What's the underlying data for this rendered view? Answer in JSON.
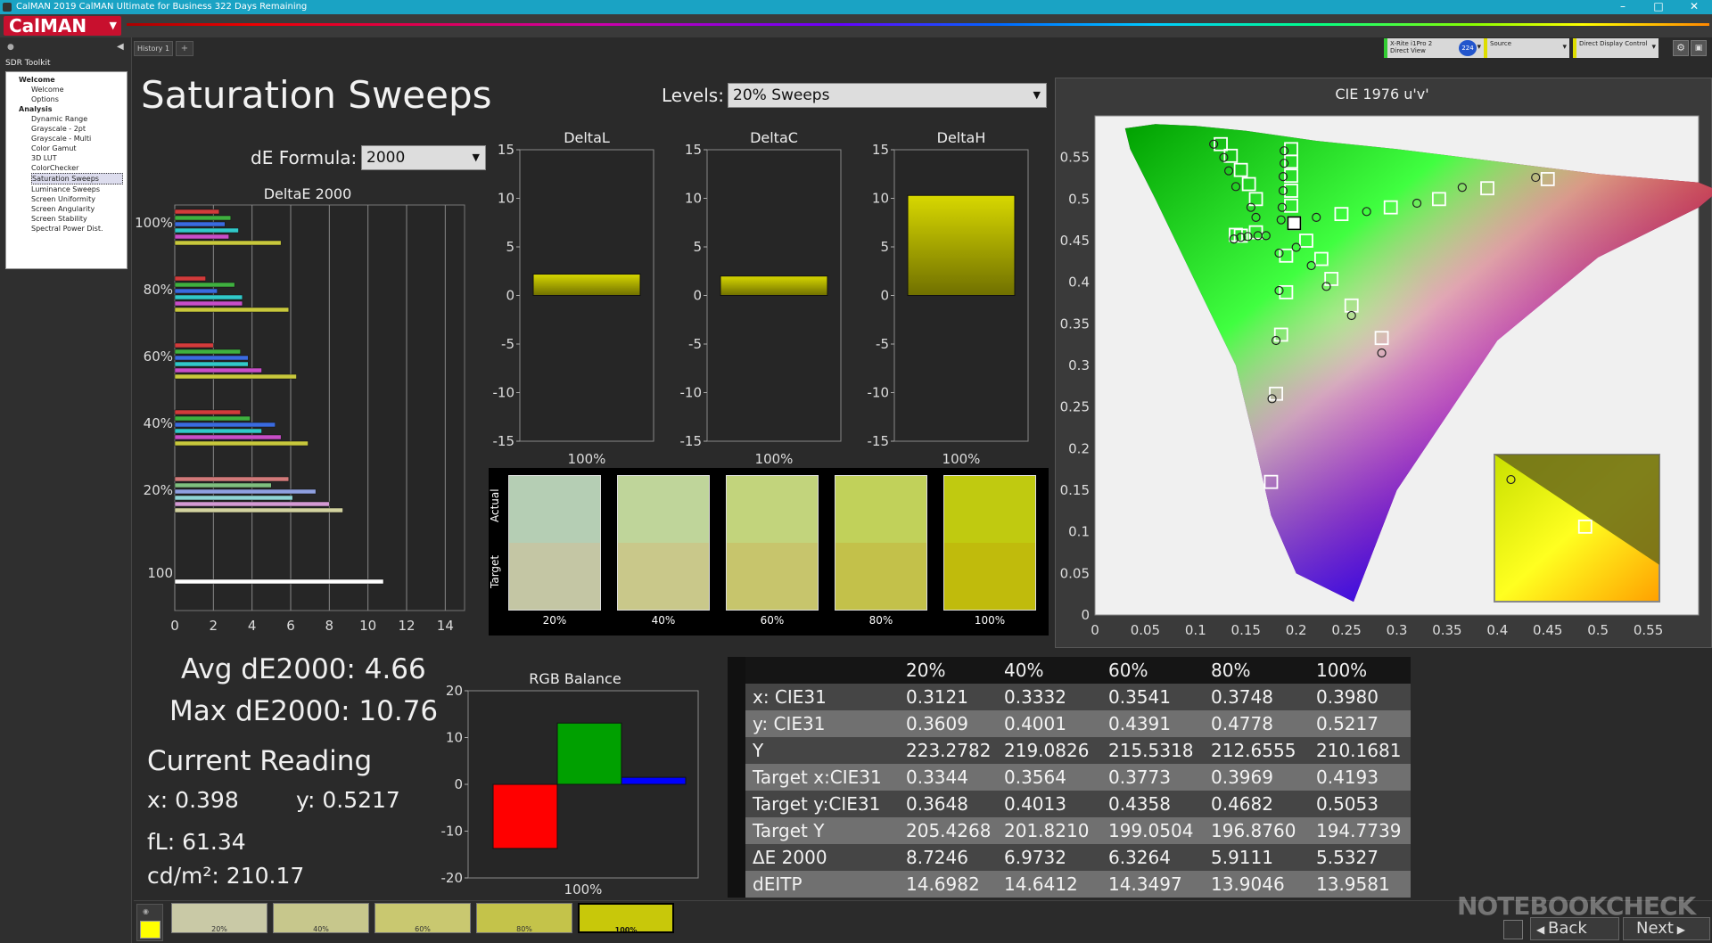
{
  "window": {
    "title": "CalMAN 2019 CalMAN Ultimate for Business 322 Days Remaining",
    "logo": "CalMAN"
  },
  "tabs": {
    "history": "History 1",
    "add": "+"
  },
  "sidebar": {
    "title": "SDR Toolkit",
    "sections": [
      {
        "label": "Welcome",
        "items": [
          "Welcome",
          "Options"
        ]
      },
      {
        "label": "Analysis",
        "items": [
          "Dynamic Range",
          "Grayscale - 2pt",
          "Grayscale - Multi",
          "Color Gamut",
          "3D LUT",
          "ColorChecker",
          "Saturation Sweeps",
          "Luminance Sweeps",
          "Screen Uniformity",
          "Screen Angularity",
          "Screen Stability",
          "Spectral Power Dist."
        ]
      }
    ],
    "selected": "Saturation Sweeps"
  },
  "devices": {
    "meter_line1": "X-Rite i1Pro 2",
    "meter_line2": "Direct View",
    "meter_badge": "224",
    "source": "Source",
    "display": "Direct Display Control"
  },
  "page": {
    "title": "Saturation Sweeps",
    "levels_label": "Levels:",
    "levels_value": "20% Sweeps",
    "de_formula_label": "dE Formula:",
    "de_formula_value": "2000"
  },
  "deltae_chart": {
    "title": "DeltaE 2000",
    "x_ticks": [
      "0",
      "2",
      "4",
      "6",
      "8",
      "10",
      "12",
      "14"
    ],
    "xlim": [
      0,
      15
    ],
    "groups": [
      {
        "label": "100%",
        "bars": [
          {
            "color": "#d23b3b",
            "value": 2.3
          },
          {
            "color": "#3fb03f",
            "value": 2.9
          },
          {
            "color": "#3a6be0",
            "value": 2.6
          },
          {
            "color": "#31c9c9",
            "value": 3.3
          },
          {
            "color": "#c84ec8",
            "value": 2.8
          },
          {
            "color": "#c8c83c",
            "value": 5.5
          }
        ]
      },
      {
        "label": "80%",
        "bars": [
          {
            "color": "#d23b3b",
            "value": 1.6
          },
          {
            "color": "#3fb03f",
            "value": 3.1
          },
          {
            "color": "#3a6be0",
            "value": 2.2
          },
          {
            "color": "#31c9c9",
            "value": 3.5
          },
          {
            "color": "#c84ec8",
            "value": 3.5
          },
          {
            "color": "#c8c83c",
            "value": 5.9
          }
        ]
      },
      {
        "label": "60%",
        "bars": [
          {
            "color": "#d23b3b",
            "value": 2.0
          },
          {
            "color": "#3fb03f",
            "value": 3.4
          },
          {
            "color": "#3a6be0",
            "value": 3.8
          },
          {
            "color": "#31c9c9",
            "value": 3.8
          },
          {
            "color": "#c84ec8",
            "value": 4.5
          },
          {
            "color": "#c8c83c",
            "value": 6.3
          }
        ]
      },
      {
        "label": "40%",
        "bars": [
          {
            "color": "#d23b3b",
            "value": 3.4
          },
          {
            "color": "#3fb03f",
            "value": 3.9
          },
          {
            "color": "#3a6be0",
            "value": 5.2
          },
          {
            "color": "#31c9c9",
            "value": 4.5
          },
          {
            "color": "#c84ec8",
            "value": 5.5
          },
          {
            "color": "#c8c83c",
            "value": 6.9
          }
        ]
      },
      {
        "label": "20%",
        "bars": [
          {
            "color": "#d27a7a",
            "value": 5.9
          },
          {
            "color": "#7fbf7f",
            "value": 5.0
          },
          {
            "color": "#8fa0e0",
            "value": 7.3
          },
          {
            "color": "#8fd5d5",
            "value": 6.1
          },
          {
            "color": "#d49ad4",
            "value": 8.0
          },
          {
            "color": "#d2d2a0",
            "value": 8.7
          }
        ]
      },
      {
        "label": "100",
        "bars": [
          {
            "color": "#ffffff",
            "value": 10.8
          }
        ]
      }
    ]
  },
  "delta_charts": [
    {
      "title": "DeltaL",
      "value": 2.2,
      "category": "100%"
    },
    {
      "title": "DeltaC",
      "value": 2.0,
      "category": "100%"
    },
    {
      "title": "DeltaH",
      "value": 10.3,
      "category": "100%"
    }
  ],
  "delta_ticks": [
    "15",
    "10",
    "5",
    "0",
    "-5",
    "-10",
    "-15"
  ],
  "swatches": {
    "actual_label": "Actual",
    "target_label": "Target",
    "items": [
      {
        "label": "20%",
        "actual": "#b5ceb4",
        "target": "#c4c6a4"
      },
      {
        "label": "40%",
        "actual": "#bfd59a",
        "target": "#c9c88a"
      },
      {
        "label": "60%",
        "actual": "#c2d47c",
        "target": "#c7c56c"
      },
      {
        "label": "80%",
        "actual": "#c1d15a",
        "target": "#c3c14a"
      },
      {
        "label": "100%",
        "actual": "#c0ca10",
        "target": "#c0bb0c"
      }
    ]
  },
  "cie": {
    "title": "CIE 1976 u'v'",
    "x_ticks": [
      "0",
      "0.05",
      "0.1",
      "0.15",
      "0.2",
      "0.25",
      "0.3",
      "0.35",
      "0.4",
      "0.45",
      "0.5",
      "0.55"
    ],
    "y_ticks": [
      "0.55",
      "0.5",
      "0.45",
      "0.4",
      "0.35",
      "0.3",
      "0.25",
      "0.2",
      "0.15",
      "0.1",
      "0.05",
      "0"
    ],
    "targets": [
      [
        0.125,
        0.566
      ],
      [
        0.135,
        0.552
      ],
      [
        0.145,
        0.535
      ],
      [
        0.153,
        0.518
      ],
      [
        0.16,
        0.5
      ],
      [
        0.195,
        0.56
      ],
      [
        0.195,
        0.545
      ],
      [
        0.195,
        0.528
      ],
      [
        0.195,
        0.51
      ],
      [
        0.195,
        0.492
      ],
      [
        0.145,
        0.456
      ],
      [
        0.14,
        0.457
      ],
      [
        0.16,
        0.46
      ],
      [
        0.21,
        0.45
      ],
      [
        0.225,
        0.428
      ],
      [
        0.235,
        0.404
      ],
      [
        0.255,
        0.372
      ],
      [
        0.285,
        0.333
      ],
      [
        0.19,
        0.432
      ],
      [
        0.19,
        0.388
      ],
      [
        0.185,
        0.337
      ],
      [
        0.18,
        0.266
      ],
      [
        0.175,
        0.16
      ],
      [
        0.245,
        0.482
      ],
      [
        0.294,
        0.49
      ],
      [
        0.342,
        0.5
      ],
      [
        0.39,
        0.513
      ],
      [
        0.45,
        0.524
      ],
      [
        0.198,
        0.471
      ]
    ],
    "measured": [
      [
        0.118,
        0.566
      ],
      [
        0.128,
        0.55
      ],
      [
        0.133,
        0.534
      ],
      [
        0.14,
        0.515
      ],
      [
        0.155,
        0.49
      ],
      [
        0.16,
        0.478
      ],
      [
        0.17,
        0.456
      ],
      [
        0.162,
        0.456
      ],
      [
        0.152,
        0.455
      ],
      [
        0.145,
        0.454
      ],
      [
        0.138,
        0.452
      ],
      [
        0.188,
        0.558
      ],
      [
        0.188,
        0.543
      ],
      [
        0.187,
        0.527
      ],
      [
        0.187,
        0.51
      ],
      [
        0.186,
        0.49
      ],
      [
        0.185,
        0.475
      ],
      [
        0.183,
        0.435
      ],
      [
        0.2,
        0.442
      ],
      [
        0.215,
        0.42
      ],
      [
        0.23,
        0.395
      ],
      [
        0.255,
        0.36
      ],
      [
        0.285,
        0.315
      ],
      [
        0.183,
        0.39
      ],
      [
        0.18,
        0.33
      ],
      [
        0.176,
        0.26
      ],
      [
        0.22,
        0.478
      ],
      [
        0.27,
        0.485
      ],
      [
        0.32,
        0.495
      ],
      [
        0.365,
        0.514
      ],
      [
        0.438,
        0.526
      ]
    ],
    "inset_points": {
      "target": [
        0.55,
        0.49
      ],
      "measured": [
        0.1,
        0.17
      ]
    }
  },
  "stats": {
    "avg": "Avg dE2000: 4.66",
    "max": "Max dE2000: 10.76",
    "current_reading": "Current Reading",
    "x": "x: 0.398",
    "y": "y: 0.5217",
    "fl": "fL: 61.34",
    "cdm2": "cd/m²: 210.17"
  },
  "rgb_balance": {
    "title": "RGB Balance",
    "y_ticks": [
      "20",
      "10",
      "0",
      "-10",
      "-20"
    ],
    "ylim": [
      -20,
      20
    ],
    "category": "100%",
    "bars": [
      {
        "name": "Red",
        "value": -13.7,
        "color": "#ff0000"
      },
      {
        "name": "Green",
        "value": 13.1,
        "color": "#00a000"
      },
      {
        "name": "Blue",
        "value": 1.5,
        "color": "#0000ff"
      }
    ]
  },
  "table": {
    "headers": [
      "",
      "20%",
      "40%",
      "60%",
      "80%",
      "100%"
    ],
    "rows": [
      [
        "x: CIE31",
        "0.3121",
        "0.3332",
        "0.3541",
        "0.3748",
        "0.3980"
      ],
      [
        "y: CIE31",
        "0.3609",
        "0.4001",
        "0.4391",
        "0.4778",
        "0.5217"
      ],
      [
        "Y",
        "223.2782",
        "219.0826",
        "215.5318",
        "212.6555",
        "210.1681"
      ],
      [
        "Target x:CIE31",
        "0.3344",
        "0.3564",
        "0.3773",
        "0.3969",
        "0.4193"
      ],
      [
        "Target y:CIE31",
        "0.3648",
        "0.4013",
        "0.4358",
        "0.4682",
        "0.5053"
      ],
      [
        "Target Y",
        "205.4268",
        "201.8210",
        "199.0504",
        "196.8760",
        "194.7739"
      ],
      [
        "ΔE 2000",
        "8.7246",
        "6.9732",
        "6.3264",
        "5.9111",
        "5.5327"
      ],
      [
        "dEITP",
        "14.6982",
        "14.6412",
        "14.3497",
        "13.9046",
        "13.9581"
      ]
    ]
  },
  "bottom_swatches": [
    {
      "label": "20%",
      "color": "#c9c9a6"
    },
    {
      "label": "40%",
      "color": "#c7c78c"
    },
    {
      "label": "60%",
      "color": "#c9c870"
    },
    {
      "label": "80%",
      "color": "#c4c34a"
    },
    {
      "label": "100%",
      "color": "#c8c80a"
    }
  ],
  "current_swatch_color": "#ffff00",
  "nav": {
    "back": "Back",
    "next": "Next"
  },
  "watermark": "NOTEBOOKCHECK"
}
